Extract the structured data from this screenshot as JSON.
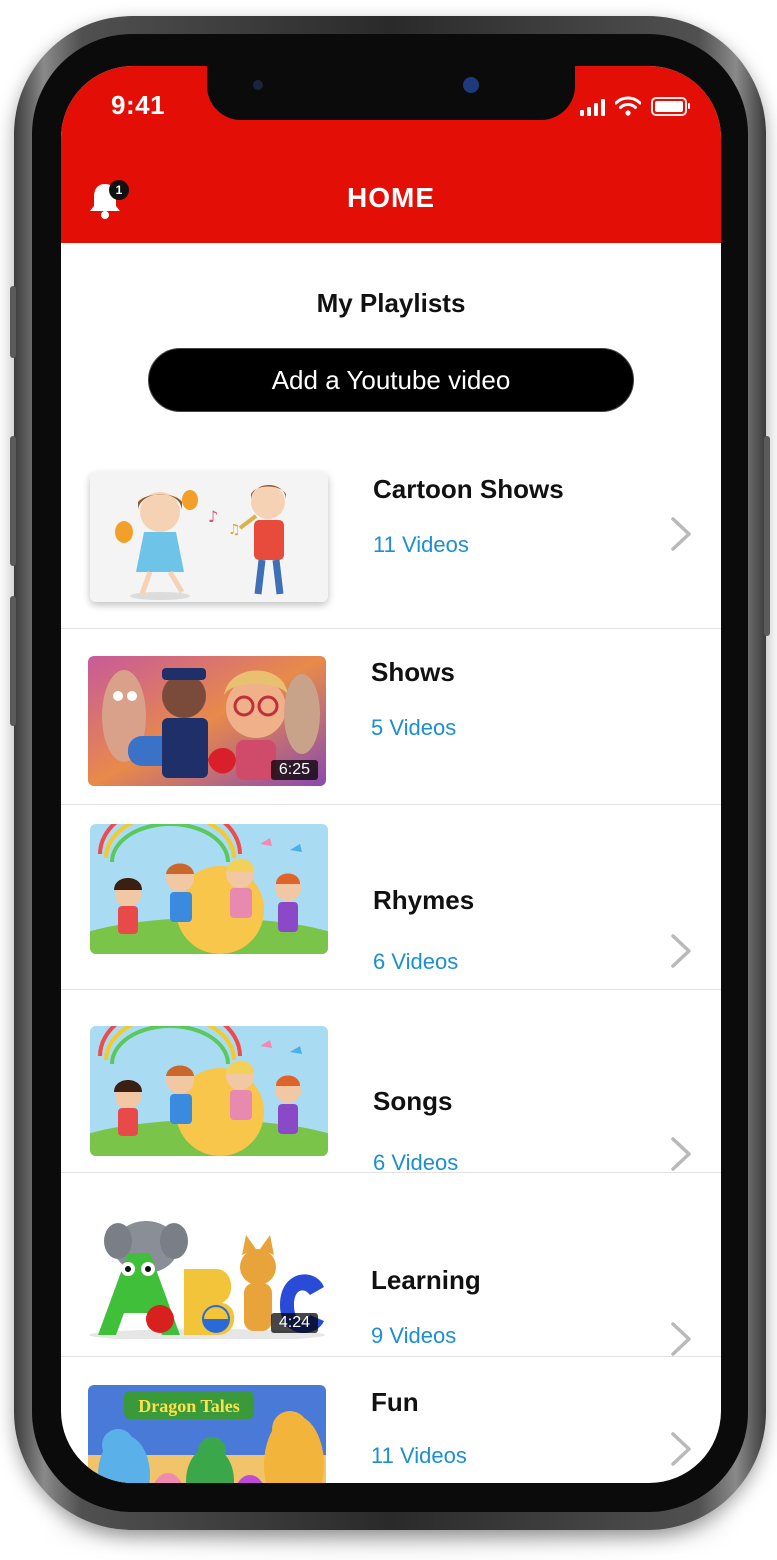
{
  "status_bar": {
    "time": "9:41"
  },
  "header": {
    "title": "HOME",
    "notification_count": "1",
    "accent_color": "#e30f06"
  },
  "section_title": "My Playlists",
  "add_button_label": "Add a Youtube video",
  "playlists": [
    {
      "name": "Cartoon Shows",
      "count": "11 Videos",
      "duration": "",
      "thumb": "kids-music"
    },
    {
      "name": "Shows",
      "count": "5 Videos",
      "duration": "6:25",
      "thumb": "animated-characters"
    },
    {
      "name": "Rhymes",
      "count": "6 Videos",
      "duration": "",
      "thumb": "kids-rainbow"
    },
    {
      "name": "Songs",
      "count": "6 Videos",
      "duration": "",
      "thumb": "kids-rainbow"
    },
    {
      "name": "Learning",
      "count": "9 Videos",
      "duration": "4:24",
      "thumb": "abc-animals"
    },
    {
      "name": "Fun",
      "count": "11 Videos",
      "duration": "",
      "thumb": "dragon-tales"
    }
  ],
  "thumb_text": {
    "dragon_tales": "Dragon Tales"
  },
  "link_color": "#1c8fd3"
}
